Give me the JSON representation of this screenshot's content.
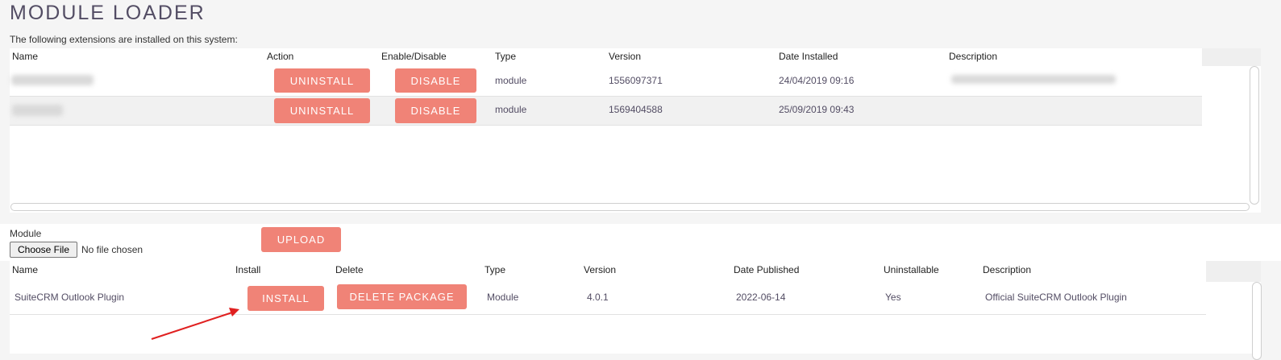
{
  "page": {
    "title": "MODULE LOADER",
    "intro": "The following extensions are installed on this system:"
  },
  "installed": {
    "headers": [
      "Name",
      "Action",
      "Enable/Disable",
      "Type",
      "Version",
      "Date Installed",
      "Description"
    ],
    "rows": [
      {
        "action": "UNINSTALL",
        "toggle": "DISABLE",
        "type": "module",
        "version": "1556097371",
        "date": "24/04/2019 09:16"
      },
      {
        "action": "UNINSTALL",
        "toggle": "DISABLE",
        "type": "module",
        "version": "1569404588",
        "date": "25/09/2019 09:43"
      }
    ]
  },
  "upload": {
    "module_label": "Module",
    "choose_file": "Choose File",
    "no_file": "No file chosen",
    "upload_button": "UPLOAD"
  },
  "packages": {
    "headers": [
      "Name",
      "Install",
      "Delete",
      "Type",
      "Version",
      "Date Published",
      "Uninstallable",
      "Description"
    ],
    "rows": [
      {
        "name": "SuiteCRM Outlook Plugin",
        "install": "INSTALL",
        "delete": "DELETE PACKAGE",
        "type": "Module",
        "version": "4.0.1",
        "date": "2022-06-14",
        "uninstallable": "Yes",
        "description": "Official SuiteCRM Outlook Plugin"
      }
    ]
  },
  "colors": {
    "accent": "#f08377",
    "title": "#534d64",
    "arrow": "#e02020"
  }
}
